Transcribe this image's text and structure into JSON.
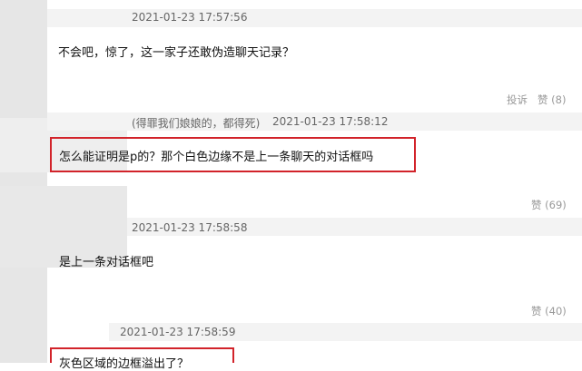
{
  "comments": [
    {
      "timestamp": "2021-01-23 17:57:56",
      "text": "不会吧，惊了，这一家子还敢伪造聊天记录？",
      "actions": {
        "report": "投诉",
        "like": "赞 (8)"
      }
    },
    {
      "nickname": "(得罪我们娘娘的，都得死)",
      "timestamp": "2021-01-23 17:58:12",
      "text": "怎么能证明是p的？那个白色边缘不是上一条聊天的对话框吗",
      "actions": {
        "like": "赞 (69)"
      }
    },
    {
      "timestamp": "2021-01-23 17:58:58",
      "text": "是上一条对话框吧",
      "actions": {
        "like": "赞 (40)"
      }
    },
    {
      "timestamp": "2021-01-23 17:58:59",
      "text": "灰色区域的边框溢出了？"
    }
  ]
}
